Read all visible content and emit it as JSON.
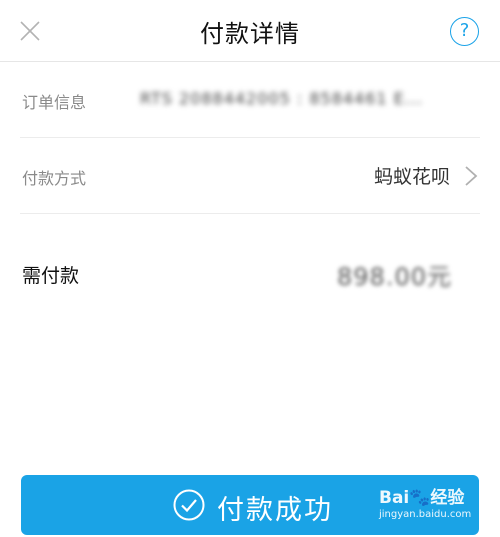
{
  "header": {
    "title": "付款详情",
    "help_label": "?"
  },
  "order": {
    "label": "订单信息",
    "value": "RTS 2088442005 : 8584461 E..."
  },
  "payment_method": {
    "label": "付款方式",
    "value": "蚂蚁花呗"
  },
  "amount": {
    "label": "需付款",
    "value": "898.00元"
  },
  "action": {
    "label": "付款成功"
  },
  "watermark": {
    "brand": "Bai🐾经验",
    "url": "jingyan.baidu.com"
  },
  "colors": {
    "accent": "#1aa3e6",
    "help_accent": "#1ba3e8"
  }
}
